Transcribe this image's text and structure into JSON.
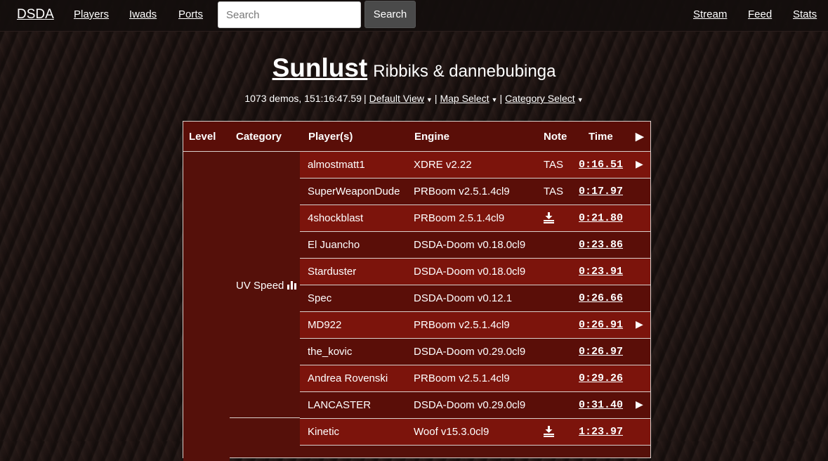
{
  "nav": {
    "brand": "DSDA",
    "players": "Players",
    "iwads": "Iwads",
    "ports": "Ports",
    "search_placeholder": "Search",
    "search_button": "Search",
    "stream": "Stream",
    "feed": "Feed",
    "stats": "Stats"
  },
  "wad": {
    "title": "Sunlust",
    "authors": "Ribbiks & dannebubinga"
  },
  "summary": {
    "stats": "1073 demos, 151:16:47.59",
    "default_view": "Default View",
    "map_select": "Map Select",
    "category_select": "Category Select"
  },
  "table": {
    "headers": {
      "level": "Level",
      "category": "Category",
      "players": "Player(s)",
      "engine": "Engine",
      "note": "Note",
      "time": "Time",
      "play": "▶"
    },
    "category": "UV Speed",
    "rows": [
      {
        "player": "almostmatt1",
        "engine": "XDRE v2.22",
        "note": "TAS",
        "time": "0:16.51",
        "video": "▶",
        "download": false
      },
      {
        "player": "SuperWeaponDude",
        "engine": "PRBoom v2.5.1.4cl9",
        "note": "TAS",
        "time": "0:17.97",
        "video": "",
        "download": false
      },
      {
        "player": "4shockblast",
        "engine": "PRBoom 2.5.1.4cl9",
        "note": "",
        "time": "0:21.80",
        "video": "",
        "download": true
      },
      {
        "player": "El Juancho",
        "engine": "DSDA-Doom v0.18.0cl9",
        "note": "",
        "time": "0:23.86",
        "video": "",
        "download": false
      },
      {
        "player": "Starduster",
        "engine": "DSDA-Doom v0.18.0cl9",
        "note": "",
        "time": "0:23.91",
        "video": "",
        "download": false
      },
      {
        "player": "Spec",
        "engine": "DSDA-Doom v0.12.1",
        "note": "",
        "time": "0:26.66",
        "video": "",
        "download": false
      },
      {
        "player": "MD922",
        "engine": "PRBoom v2.5.1.4cl9",
        "note": "",
        "time": "0:26.91",
        "video": "▶",
        "download": false
      },
      {
        "player": "the_kovic",
        "engine": "DSDA-Doom v0.29.0cl9",
        "note": "",
        "time": "0:26.97",
        "video": "",
        "download": false
      },
      {
        "player": "Andrea Rovenski",
        "engine": "PRBoom v2.5.1.4cl9",
        "note": "",
        "time": "0:29.26",
        "video": "",
        "download": false
      },
      {
        "player": "LANCASTER",
        "engine": "DSDA-Doom v0.29.0cl9",
        "note": "",
        "time": "0:31.40",
        "video": "▶",
        "download": false
      },
      {
        "player": "Kinetic",
        "engine": "Woof v15.3.0cl9",
        "note": "",
        "time": "1:23.97",
        "video": "",
        "download": true
      }
    ]
  },
  "colors": {
    "row_light": "#7c140c",
    "row_dark": "#5a0e08",
    "navbar": "#140e0d",
    "border": "#d9d0cc"
  }
}
